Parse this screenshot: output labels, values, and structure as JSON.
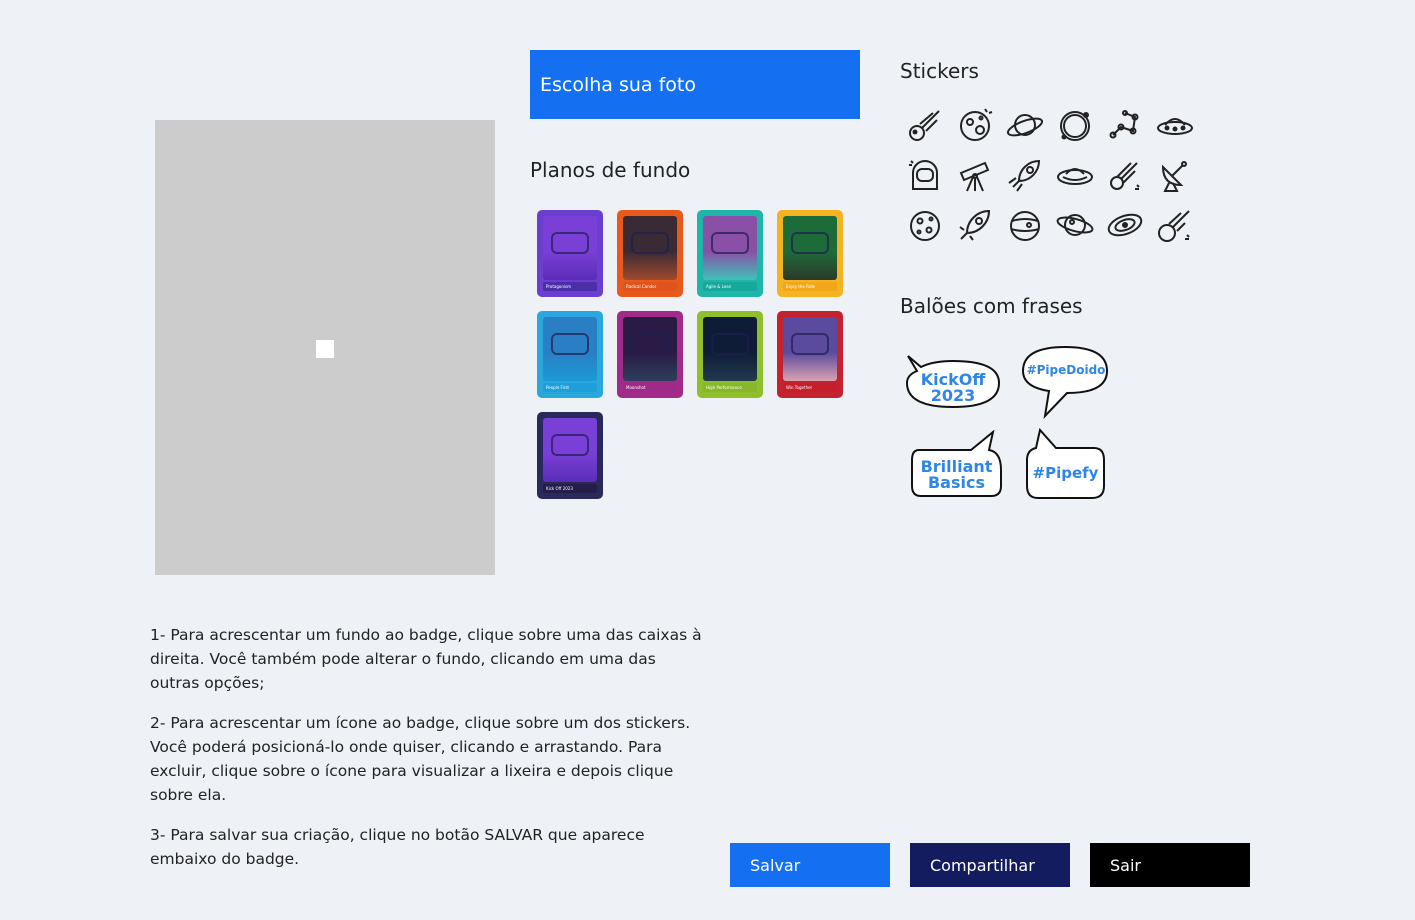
{
  "photo_button": {
    "label": "Escolha sua foto"
  },
  "backgrounds": {
    "title": "Planos de fundo",
    "items": [
      {
        "label": "Protagonism",
        "border": "#6a3fd0",
        "sky": "#7a3fd6",
        "floor": "#5a2db8",
        "footer": "#4b2fa8"
      },
      {
        "label": "Radical Candor",
        "border": "#e85a1c",
        "sky": "#3a2a34",
        "floor": "#a14a2e",
        "footer": "#e0531e"
      },
      {
        "label": "Agile & Lean",
        "border": "#1fb5a8",
        "sky": "#8a4fa6",
        "floor": "#3fc2b8",
        "footer": "#16a89b"
      },
      {
        "label": "Enjoy the Ride",
        "border": "#f4b322",
        "sky": "#1e6b3a",
        "floor": "#2c3a2a",
        "footer": "#f0a818"
      },
      {
        "label": "People First",
        "border": "#2aa7dd",
        "sky": "#2a7fc4",
        "floor": "#1b9ad6",
        "footer": "#1f9fd9"
      },
      {
        "label": "Moonshot",
        "border": "#a22b8a",
        "sky": "#2a1b46",
        "floor": "#2d3e5c",
        "footer": "#a02a88"
      },
      {
        "label": "High Performance",
        "border": "#8fbf2b",
        "sky": "#0f1c38",
        "floor": "#203a4e",
        "footer": "#86b82a"
      },
      {
        "label": "Win Together",
        "border": "#c4222f",
        "sky": "#5a4b9e",
        "floor": "#d9a2b0",
        "footer": "#c41f2c"
      },
      {
        "label": "Kick Off 2023",
        "border": "#2a2a5a",
        "sky": "#7a3fd6",
        "floor": "#5a2db8",
        "footer": "#231f4a"
      }
    ]
  },
  "stickers": {
    "title": "Stickers",
    "items": [
      "comet-icon",
      "planet-craters-icon",
      "saturn-icon",
      "orbit-ring-icon",
      "constellation-icon",
      "ufo-icon",
      "astronaut-helmet-icon",
      "telescope-icon",
      "rocket-icon",
      "flying-saucer-icon",
      "shooting-star-icon",
      "satellite-dish-icon",
      "moon-icon",
      "rocket-launch-icon",
      "jupiter-icon",
      "planet-orbit-icon",
      "galaxy-icon",
      "meteor-icon"
    ]
  },
  "balloons": {
    "title": "Balões com frases",
    "items": [
      {
        "line1": "KickOff",
        "line2": "2023"
      },
      {
        "line1": "#PipeDoido",
        "line2": ""
      },
      {
        "line1": "Brilliant",
        "line2": "Basics"
      },
      {
        "line1": "#Pipefy",
        "line2": ""
      }
    ]
  },
  "instructions": {
    "step1": "1- Para acrescentar um fundo ao badge, clique sobre uma das caixas à direita. Você também pode alterar o fundo, clicando em uma das outras opções;",
    "step2": "2- Para acrescentar um ícone ao badge, clique sobre um dos stickers. Você poderá posicioná-lo onde quiser, clicando e arrastando. Para excluir, clique sobre o ícone para visualizar a lixeira e depois clique sobre ela.",
    "step3": "3- Para salvar sua criação, clique no botão SALVAR que aparece embaixo do badge."
  },
  "actions": {
    "save": "Salvar",
    "share": "Compartilhar",
    "exit": "Sair"
  }
}
